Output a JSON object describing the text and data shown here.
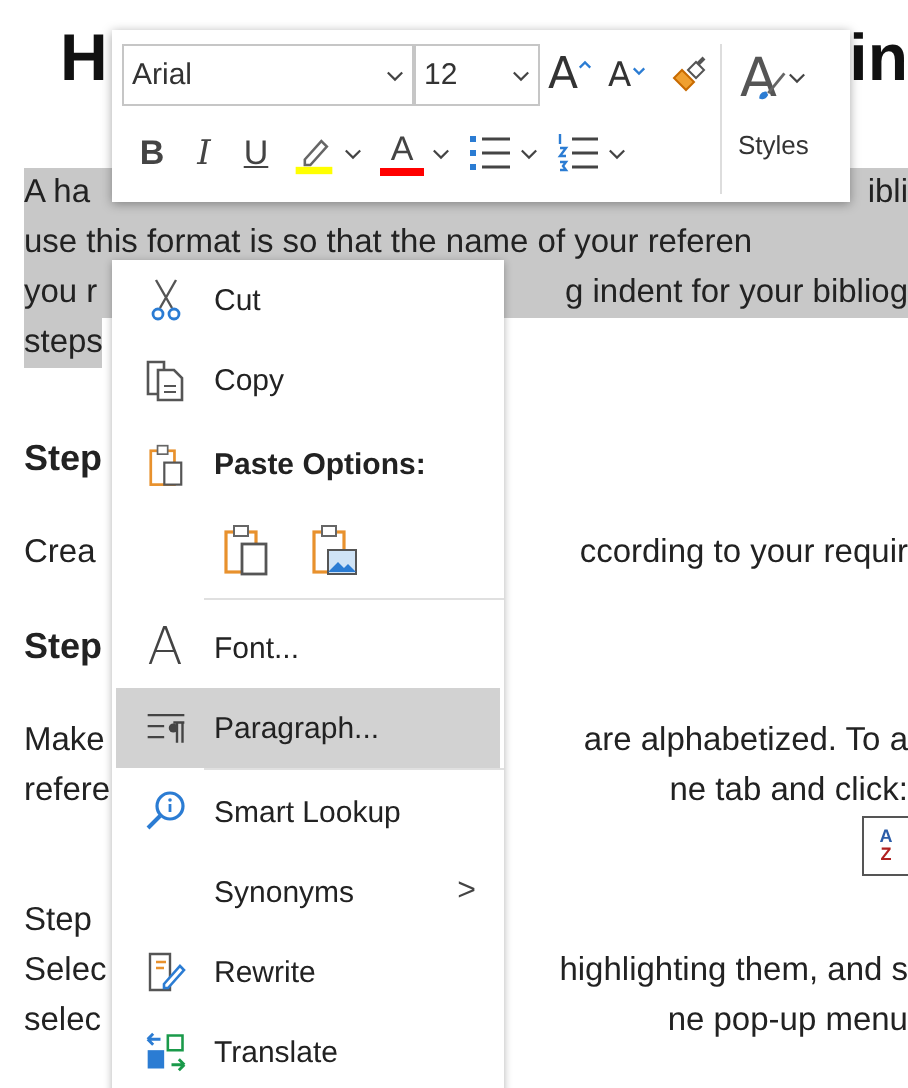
{
  "document": {
    "title": {
      "left": "H",
      "right": "in"
    },
    "paragraphs": [
      {
        "kind": "highlighted",
        "lines": [
          {
            "left": "A ha",
            "right": "ibli"
          },
          {
            "left": "use this format is so that the name of your referen"
          },
          {
            "left": "you r",
            "right": "g indent for your bibliog"
          },
          {
            "left": "steps"
          }
        ]
      },
      {
        "kind": "heading",
        "lines": [
          {
            "left": "Step"
          }
        ]
      },
      {
        "kind": "body",
        "lines": [
          {
            "left": "Crea",
            "right": "ccording to your requir"
          }
        ]
      },
      {
        "kind": "heading",
        "lines": [
          {
            "left": "Step"
          }
        ]
      },
      {
        "kind": "body",
        "lines": [
          {
            "left": "Make",
            "right": "are alphabetized. To a"
          },
          {
            "left": "refere",
            "right": "ne tab and click:"
          }
        ]
      },
      {
        "kind": "sort",
        "sort_glyphs": [
          "A",
          "Z"
        ]
      },
      {
        "kind": "body",
        "lines": [
          {
            "left": "Step"
          },
          {
            "left": "Selec",
            "right": "highlighting them, and s"
          },
          {
            "left": "selec",
            "right": "ne pop-up menu"
          }
        ]
      }
    ]
  },
  "mini_toolbar": {
    "font": "Arial",
    "size": "12",
    "row1": [
      {
        "kind": "grow",
        "glyph": "A"
      },
      {
        "kind": "shrink",
        "glyph": "A"
      },
      {
        "kind": "painter"
      }
    ],
    "row2": [
      {
        "kind": "bold",
        "glyph": "B"
      },
      {
        "kind": "italic",
        "glyph": "I"
      },
      {
        "kind": "underline",
        "glyph": "U"
      },
      {
        "kind": "highlight",
        "color": "#ffff00"
      },
      {
        "kind": "fontcolor",
        "glyph": "A",
        "color": "#ff0000"
      },
      {
        "kind": "bullets"
      },
      {
        "kind": "numbering"
      }
    ],
    "styles": {
      "glyph": "A",
      "label": "Styles"
    }
  },
  "context_menu": [
    {
      "kind": "command",
      "label": "Cut",
      "highlighted": false
    },
    {
      "kind": "command",
      "label": "Copy",
      "highlighted": false
    },
    {
      "kind": "header",
      "label": "Paste Options:",
      "highlighted": false
    },
    {
      "kind": "paste_icons"
    },
    {
      "kind": "command",
      "label": "Font...",
      "glyph": "A",
      "highlighted": false
    },
    {
      "kind": "command",
      "label": "Paragraph...",
      "highlighted": true
    },
    {
      "kind": "command",
      "label": "Smart Lookup",
      "highlighted": false
    },
    {
      "kind": "submenu",
      "label": "Synonyms",
      "arrow": ">",
      "highlighted": false
    },
    {
      "kind": "command",
      "label": "Rewrite",
      "highlighted": false
    },
    {
      "kind": "command",
      "label": "Translate",
      "highlighted": false
    }
  ]
}
